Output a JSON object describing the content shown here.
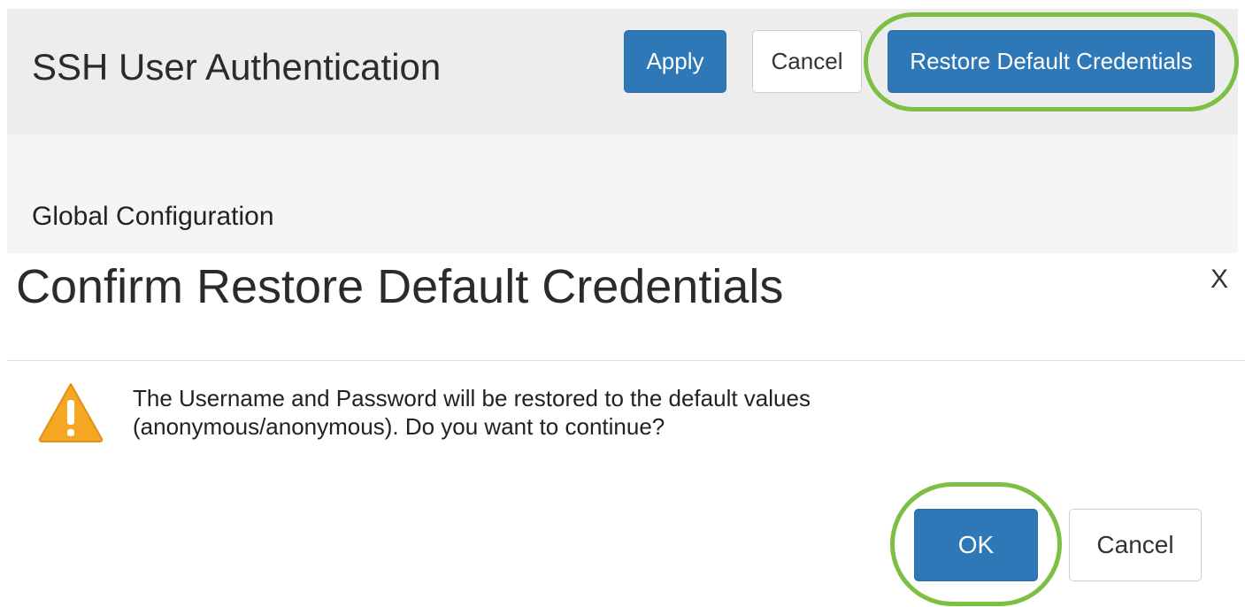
{
  "header": {
    "title": "SSH User Authentication",
    "apply_label": "Apply",
    "cancel_label": "Cancel",
    "restore_label": "Restore Default Credentials"
  },
  "section": {
    "label": "Global Configuration"
  },
  "dialog": {
    "title": "Confirm Restore Default Credentials",
    "close_label": "X",
    "message_line1": "The Username and Password will be restored to the default values",
    "message_line2": "(anonymous/anonymous). Do you want to continue?",
    "ok_label": "OK",
    "cancel_label": "Cancel",
    "icon": "warning-icon"
  },
  "colors": {
    "primary": "#2e78b8",
    "highlight_ring": "#7cc043",
    "warning": "#f5a623"
  }
}
